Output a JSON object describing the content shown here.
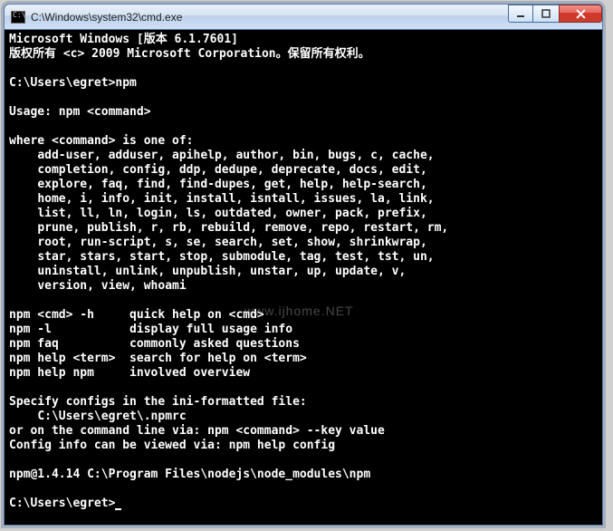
{
  "window": {
    "title": "C:\\Windows\\system32\\cmd.exe",
    "icon_label": "C:\\"
  },
  "terminal": {
    "header_line1": "Microsoft Windows [版本 6.1.7601]",
    "header_line2": "版权所有 <c> 2009 Microsoft Corporation。保留所有权利。",
    "prompt1": "C:\\Users\\egret>npm",
    "usage": "Usage: npm <command>",
    "where_header": "where <command> is one of:",
    "commands_block": "    add-user, adduser, apihelp, author, bin, bugs, c, cache,\n    completion, config, ddp, dedupe, deprecate, docs, edit,\n    explore, faq, find, find-dupes, get, help, help-search,\n    home, i, info, init, install, isntall, issues, la, link,\n    list, ll, ln, login, ls, outdated, owner, pack, prefix,\n    prune, publish, r, rb, rebuild, remove, repo, restart, rm,\n    root, run-script, s, se, search, set, show, shrinkwrap,\n    star, stars, start, stop, submodule, tag, test, tst, un,\n    uninstall, unlink, unpublish, unstar, up, update, v,\n    version, view, whoami",
    "help_line1": "npm <cmd> -h     quick help on <cmd>",
    "help_line2": "npm -l           display full usage info",
    "help_line3": "npm faq          commonly asked questions",
    "help_line4": "npm help <term>  search for help on <term>",
    "help_line5": "npm help npm     involved overview",
    "config_line1": "Specify configs in the ini-formatted file:",
    "config_line2": "    C:\\Users\\egret\\.npmrc",
    "config_line3": "or on the command line via: npm <command> --key value",
    "config_line4": "Config info can be viewed via: npm help config",
    "version_line": "npm@1.4.14 C:\\Program Files\\nodejs\\node_modules\\npm",
    "prompt2": "C:\\Users\\egret>"
  },
  "watermark": "www.ijhome.NET"
}
